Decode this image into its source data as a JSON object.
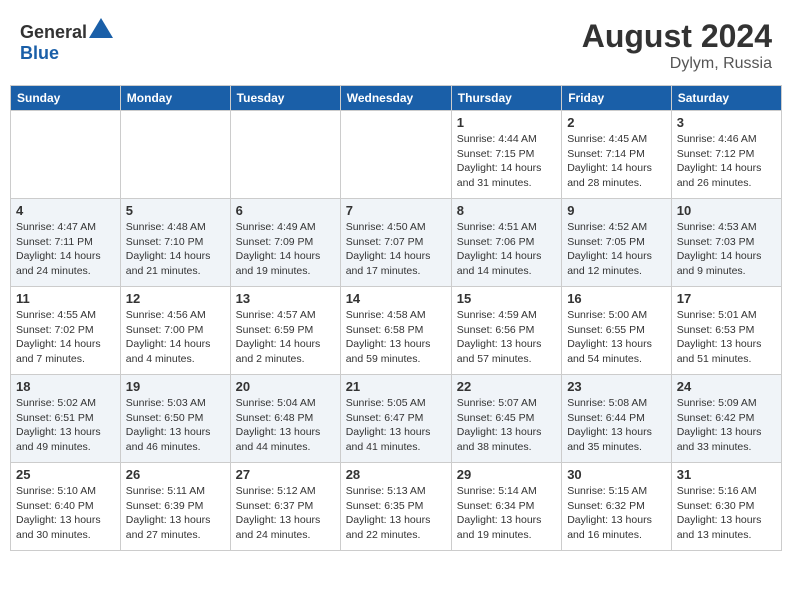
{
  "header": {
    "logo_general": "General",
    "logo_blue": "Blue",
    "month_year": "August 2024",
    "location": "Dylym, Russia"
  },
  "weekdays": [
    "Sunday",
    "Monday",
    "Tuesday",
    "Wednesday",
    "Thursday",
    "Friday",
    "Saturday"
  ],
  "weeks": [
    [
      null,
      null,
      null,
      null,
      {
        "day": 1,
        "sunrise": "4:44 AM",
        "sunset": "7:15 PM",
        "daylight": "14 hours and 31 minutes."
      },
      {
        "day": 2,
        "sunrise": "4:45 AM",
        "sunset": "7:14 PM",
        "daylight": "14 hours and 28 minutes."
      },
      {
        "day": 3,
        "sunrise": "4:46 AM",
        "sunset": "7:12 PM",
        "daylight": "14 hours and 26 minutes."
      }
    ],
    [
      {
        "day": 4,
        "sunrise": "4:47 AM",
        "sunset": "7:11 PM",
        "daylight": "14 hours and 24 minutes."
      },
      {
        "day": 5,
        "sunrise": "4:48 AM",
        "sunset": "7:10 PM",
        "daylight": "14 hours and 21 minutes."
      },
      {
        "day": 6,
        "sunrise": "4:49 AM",
        "sunset": "7:09 PM",
        "daylight": "14 hours and 19 minutes."
      },
      {
        "day": 7,
        "sunrise": "4:50 AM",
        "sunset": "7:07 PM",
        "daylight": "14 hours and 17 minutes."
      },
      {
        "day": 8,
        "sunrise": "4:51 AM",
        "sunset": "7:06 PM",
        "daylight": "14 hours and 14 minutes."
      },
      {
        "day": 9,
        "sunrise": "4:52 AM",
        "sunset": "7:05 PM",
        "daylight": "14 hours and 12 minutes."
      },
      {
        "day": 10,
        "sunrise": "4:53 AM",
        "sunset": "7:03 PM",
        "daylight": "14 hours and 9 minutes."
      }
    ],
    [
      {
        "day": 11,
        "sunrise": "4:55 AM",
        "sunset": "7:02 PM",
        "daylight": "14 hours and 7 minutes."
      },
      {
        "day": 12,
        "sunrise": "4:56 AM",
        "sunset": "7:00 PM",
        "daylight": "14 hours and 4 minutes."
      },
      {
        "day": 13,
        "sunrise": "4:57 AM",
        "sunset": "6:59 PM",
        "daylight": "14 hours and 2 minutes."
      },
      {
        "day": 14,
        "sunrise": "4:58 AM",
        "sunset": "6:58 PM",
        "daylight": "13 hours and 59 minutes."
      },
      {
        "day": 15,
        "sunrise": "4:59 AM",
        "sunset": "6:56 PM",
        "daylight": "13 hours and 57 minutes."
      },
      {
        "day": 16,
        "sunrise": "5:00 AM",
        "sunset": "6:55 PM",
        "daylight": "13 hours and 54 minutes."
      },
      {
        "day": 17,
        "sunrise": "5:01 AM",
        "sunset": "6:53 PM",
        "daylight": "13 hours and 51 minutes."
      }
    ],
    [
      {
        "day": 18,
        "sunrise": "5:02 AM",
        "sunset": "6:51 PM",
        "daylight": "13 hours and 49 minutes."
      },
      {
        "day": 19,
        "sunrise": "5:03 AM",
        "sunset": "6:50 PM",
        "daylight": "13 hours and 46 minutes."
      },
      {
        "day": 20,
        "sunrise": "5:04 AM",
        "sunset": "6:48 PM",
        "daylight": "13 hours and 44 minutes."
      },
      {
        "day": 21,
        "sunrise": "5:05 AM",
        "sunset": "6:47 PM",
        "daylight": "13 hours and 41 minutes."
      },
      {
        "day": 22,
        "sunrise": "5:07 AM",
        "sunset": "6:45 PM",
        "daylight": "13 hours and 38 minutes."
      },
      {
        "day": 23,
        "sunrise": "5:08 AM",
        "sunset": "6:44 PM",
        "daylight": "13 hours and 35 minutes."
      },
      {
        "day": 24,
        "sunrise": "5:09 AM",
        "sunset": "6:42 PM",
        "daylight": "13 hours and 33 minutes."
      }
    ],
    [
      {
        "day": 25,
        "sunrise": "5:10 AM",
        "sunset": "6:40 PM",
        "daylight": "13 hours and 30 minutes."
      },
      {
        "day": 26,
        "sunrise": "5:11 AM",
        "sunset": "6:39 PM",
        "daylight": "13 hours and 27 minutes."
      },
      {
        "day": 27,
        "sunrise": "5:12 AM",
        "sunset": "6:37 PM",
        "daylight": "13 hours and 24 minutes."
      },
      {
        "day": 28,
        "sunrise": "5:13 AM",
        "sunset": "6:35 PM",
        "daylight": "13 hours and 22 minutes."
      },
      {
        "day": 29,
        "sunrise": "5:14 AM",
        "sunset": "6:34 PM",
        "daylight": "13 hours and 19 minutes."
      },
      {
        "day": 30,
        "sunrise": "5:15 AM",
        "sunset": "6:32 PM",
        "daylight": "13 hours and 16 minutes."
      },
      {
        "day": 31,
        "sunrise": "5:16 AM",
        "sunset": "6:30 PM",
        "daylight": "13 hours and 13 minutes."
      }
    ]
  ]
}
